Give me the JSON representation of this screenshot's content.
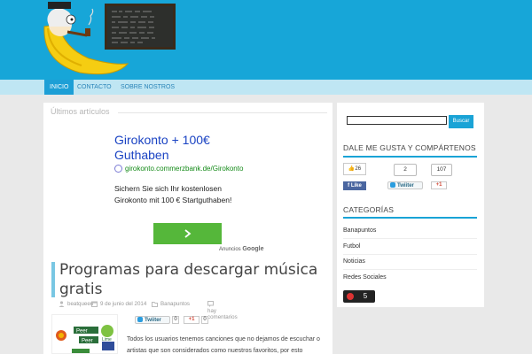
{
  "nav": {
    "items": [
      "INICIO",
      "CONTACTO",
      "SOBRE NOSTROS"
    ]
  },
  "main": {
    "section_title": "Últimos artículos",
    "ad": {
      "title": "Girokonto + 100€ Guthaben",
      "url": "girokonto.commerzbank.de/Girokonto",
      "text": "Sichern Sie sich Ihr kostenlosen Girokonto mit 100 € Startguthaben!",
      "credit_label": "Anuncios",
      "credit_brand": "Google"
    },
    "post": {
      "title": "Programas para descargar música gratis",
      "author": "beatqueen",
      "date": "9 de junio del 2014",
      "category": "Banapuntos",
      "comments": "hay comentarios",
      "tweet_label": "Twiiter",
      "tweet_count": "0",
      "gplus_label": "+1",
      "gplus_count": "0",
      "thumb_labels": [
        "Peer",
        "Peer",
        "Lime"
      ],
      "excerpt": "Todos los usuarios tenemos canciones que no dejamos de escuchar o artistas que son considerados como nuestros favoritos, por esto"
    }
  },
  "sidebar": {
    "search_button": "Buscar",
    "social_title": "DALE ME GUSTA Y COMPÁRTENOS",
    "like_count": "26",
    "like_label": "Like",
    "tweet_count": "2",
    "tweet_label": "Twiiter",
    "gplus_count": "107",
    "gplus_label": "+1",
    "categories_title": "CATEGORÍAS",
    "categories": [
      "Banapuntos",
      "Futbol",
      "Noticias",
      "Redes Sociales"
    ],
    "counter": "5"
  },
  "colors": {
    "header": "#17a6d8",
    "accent": "#19a3d6",
    "ad_button": "#55b73a"
  }
}
